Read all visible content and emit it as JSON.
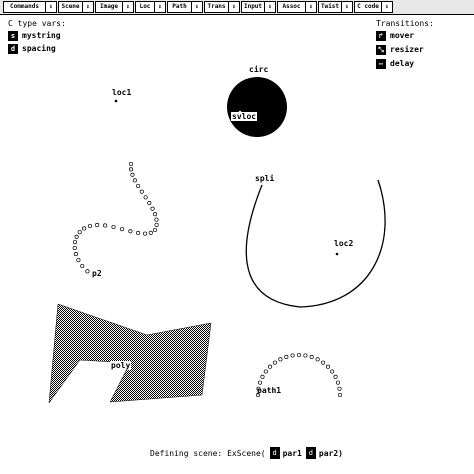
{
  "menu": [
    {
      "label": "Commands"
    },
    {
      "label": "Scene"
    },
    {
      "label": "Image"
    },
    {
      "label": "Loc"
    },
    {
      "label": "Path"
    },
    {
      "label": "Trans"
    },
    {
      "label": "Input"
    },
    {
      "label": "Assoc"
    },
    {
      "label": "Twist"
    },
    {
      "label": "C code"
    }
  ],
  "arrow_glyph": "⬇",
  "ctype_panel": {
    "title": "C type vars:",
    "items": [
      {
        "label": "mystring",
        "icon": "string-icon"
      },
      {
        "label": "spacing",
        "icon": "number-icon"
      }
    ]
  },
  "transitions_panel": {
    "title": "Transitions:",
    "items": [
      {
        "label": "mover",
        "icon": "mover-icon"
      },
      {
        "label": "resizer",
        "icon": "resizer-icon"
      },
      {
        "label": "delay",
        "icon": "delay-icon"
      }
    ]
  },
  "objects": {
    "loc1": "loc1",
    "circ": "circ",
    "svloc": "svloc",
    "spli": "spli",
    "loc2": "loc2",
    "p2": "p2",
    "poly": "poly",
    "path1": "path1"
  },
  "status": {
    "prefix": "Defining scene:",
    "scene": "ExScene(",
    "par1": "par1",
    "par2": "par2)"
  }
}
